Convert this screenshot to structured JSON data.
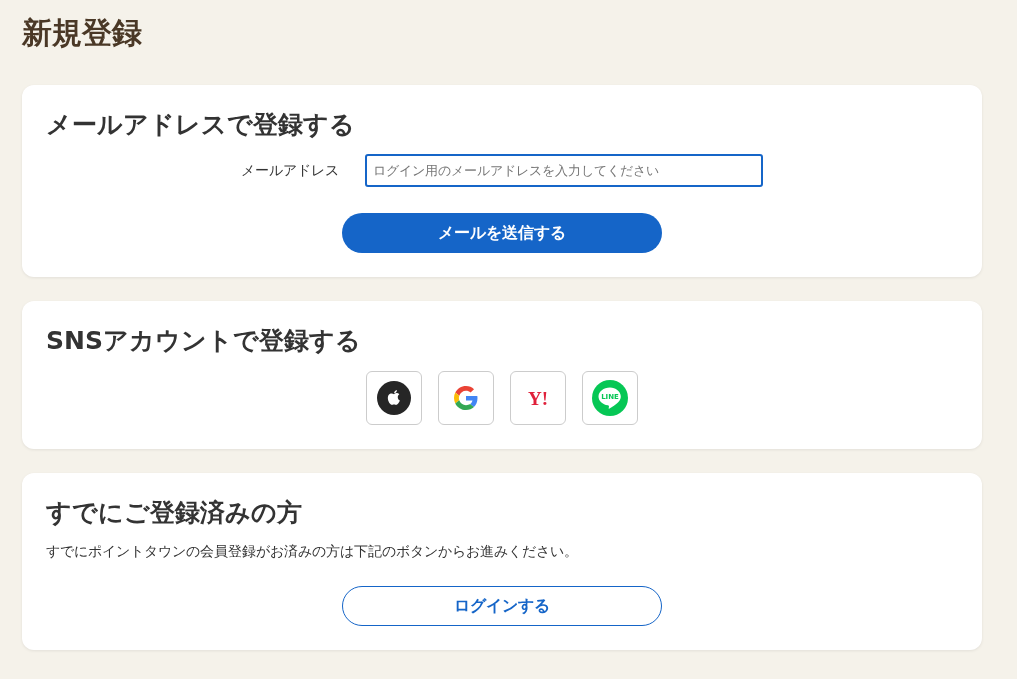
{
  "page_title": "新規登録",
  "sections": [
    {
      "kind": "email",
      "heading": "メールアドレスで登録する",
      "field": {
        "label": "メールアドレス",
        "placeholder": "ログイン用のメールアドレスを入力してください"
      },
      "button": {
        "label": "メールを送信する",
        "kind": "filled"
      }
    },
    {
      "kind": "sns",
      "heading": "SNSアカウントで登録する",
      "providers": [
        {
          "kind": "apple"
        },
        {
          "kind": "google"
        },
        {
          "kind": "yahoo",
          "logo_text": "Y!"
        },
        {
          "kind": "line",
          "logo_text": "LINE"
        }
      ]
    },
    {
      "kind": "login",
      "heading": "すでにご登録済みの方",
      "description": "すでにポイントタウンの会員登録がお済みの方は下記のボタンからお進みください。",
      "button": {
        "label": "ログインする",
        "kind": "outline"
      }
    }
  ]
}
